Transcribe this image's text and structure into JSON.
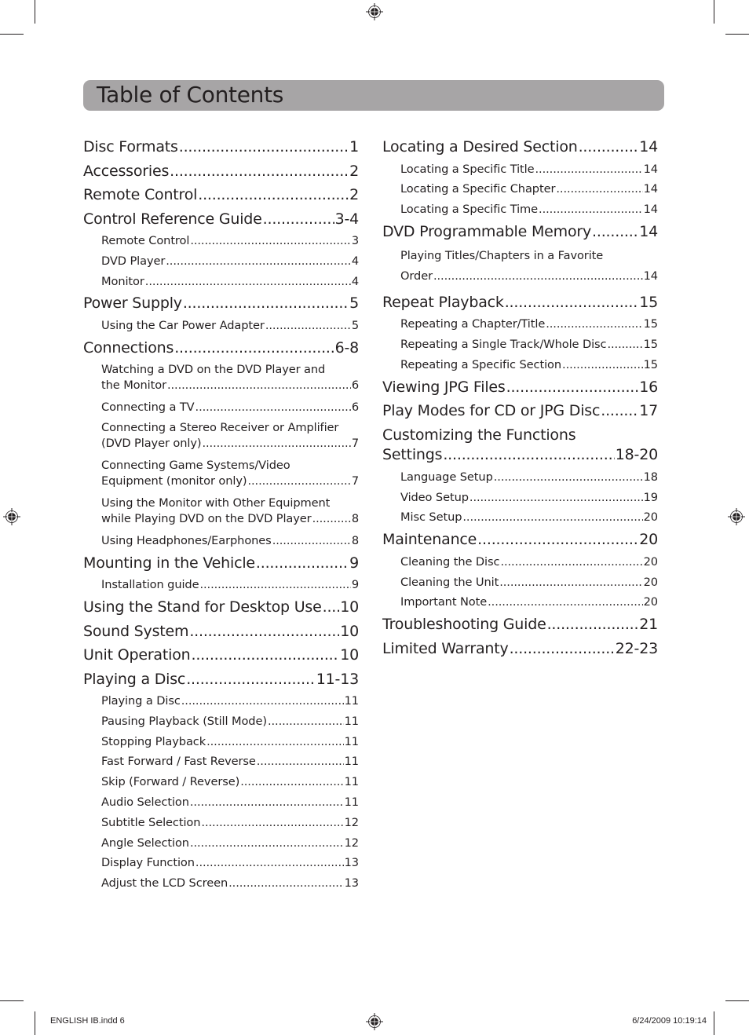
{
  "header": {
    "title": "Table of Contents"
  },
  "left_column": [
    {
      "level": 1,
      "text": "Disc Formats",
      "page": "1"
    },
    {
      "level": 1,
      "text": "Accessories",
      "page": "2"
    },
    {
      "level": 1,
      "text": "Remote Control",
      "page": "2"
    },
    {
      "level": 1,
      "text": "Control Reference Guide",
      "page": "3-4"
    },
    {
      "level": 2,
      "text": "Remote Control",
      "page": "3"
    },
    {
      "level": 2,
      "text": "DVD Player",
      "page": "4"
    },
    {
      "level": 2,
      "text": "Monitor",
      "page": "4"
    },
    {
      "level": 1,
      "text": "Power Supply",
      "page": "5"
    },
    {
      "level": 2,
      "text": "Using the Car Power Adapter",
      "page": "5"
    },
    {
      "level": 1,
      "text": "Connections",
      "page": "6-8"
    },
    {
      "level": 2,
      "text": "Watching a DVD on the DVD Player and",
      "text2": "the Monitor",
      "page": "6"
    },
    {
      "level": 2,
      "text": "Connecting a TV",
      "page": "6"
    },
    {
      "level": 2,
      "text": "Connecting a Stereo Receiver or Amplifier",
      "text2": "(DVD Player only)",
      "page": "7"
    },
    {
      "level": 2,
      "text": "Connecting Game Systems/Video",
      "text2": "Equipment (monitor only)",
      "page": "7"
    },
    {
      "level": 2,
      "text": "Using the Monitor with Other Equipment",
      "text2": "while Playing DVD on the DVD Player",
      "page": "8"
    },
    {
      "level": 2,
      "text": "Using Headphones/Earphones",
      "page": "8"
    },
    {
      "level": 1,
      "text": "Mounting in the Vehicle",
      "page": "9"
    },
    {
      "level": 2,
      "text": "Installation guide",
      "page": "9"
    },
    {
      "level": 1,
      "text": "Using the Stand for Desktop Use",
      "page": "10"
    },
    {
      "level": 1,
      "text": "Sound System",
      "page": "10"
    },
    {
      "level": 1,
      "text": "Unit Operation",
      "page": "10"
    },
    {
      "level": 1,
      "text": "Playing a Disc",
      "page": "11-13"
    },
    {
      "level": 2,
      "text": "Playing a Disc",
      "page": "11"
    },
    {
      "level": 2,
      "text": "Pausing Playback (Still Mode)",
      "page": "11"
    },
    {
      "level": 2,
      "text": "Stopping Playback",
      "page": "11"
    },
    {
      "level": 2,
      "text": "Fast Forward / Fast Reverse",
      "page": "11"
    },
    {
      "level": 2,
      "text": "Skip (Forward / Reverse)",
      "page": "11"
    },
    {
      "level": 2,
      "text": "Audio  Selection",
      "page": "11"
    },
    {
      "level": 2,
      "text": "Subtitle Selection",
      "page": "12"
    },
    {
      "level": 2,
      "text": "Angle Selection",
      "page": "12"
    },
    {
      "level": 2,
      "text": "Display Function",
      "page": "13"
    },
    {
      "level": 2,
      "text": "Adjust the LCD Screen",
      "page": "13"
    }
  ],
  "right_column": [
    {
      "level": 1,
      "text": "Locating a Desired Section",
      "page": "14"
    },
    {
      "level": 2,
      "text": "Locating a Specific Title",
      "page": "14"
    },
    {
      "level": 2,
      "text": "Locating a Specific Chapter",
      "page": "14"
    },
    {
      "level": 2,
      "text": "Locating a Specific Time",
      "page": "14"
    },
    {
      "level": 1,
      "text": "DVD Programmable Memory",
      "page": "14"
    },
    {
      "level": 2,
      "text": "Playing Titles/Chapters in a Favorite",
      "text2": "Order",
      "page": "14",
      "loose": true
    },
    {
      "level": 1,
      "text": "Repeat Playback",
      "page": "15"
    },
    {
      "level": 2,
      "text": "Repeating a Chapter/Title",
      "page": " 15"
    },
    {
      "level": 2,
      "text": "Repeating a Single Track/Whole Disc",
      "page": " 15"
    },
    {
      "level": 2,
      "text": "Repeating a Specific Section",
      "page": " 15"
    },
    {
      "level": 1,
      "text": "Viewing JPG Files",
      "page": "16"
    },
    {
      "level": 1,
      "text": "Play Modes for CD or JPG Disc",
      "page": "17"
    },
    {
      "level": 1,
      "text": "Customizing the Functions",
      "text2": "Settings",
      "page": "18-20"
    },
    {
      "level": 2,
      "text": "Language Setup",
      "page": "18"
    },
    {
      "level": 2,
      "text": "Video Setup",
      "page": "19"
    },
    {
      "level": 2,
      "text": "Misc Setup",
      "page": "20"
    },
    {
      "level": 1,
      "text": "Maintenance",
      "page": "20"
    },
    {
      "level": 2,
      "text": "Cleaning the Disc",
      "page": "20"
    },
    {
      "level": 2,
      "text": "Cleaning the Unit",
      "page": "20"
    },
    {
      "level": 2,
      "text": "Important Note",
      "page": "20"
    },
    {
      "level": 1,
      "text": "Troubleshooting Guide",
      "page": "21"
    },
    {
      "level": 1,
      "text": "Limited Warranty",
      "page": "22-23"
    }
  ],
  "footer": {
    "file": "ENGLISH IB.indd   6",
    "timestamp": "6/24/2009   10:19:14"
  }
}
